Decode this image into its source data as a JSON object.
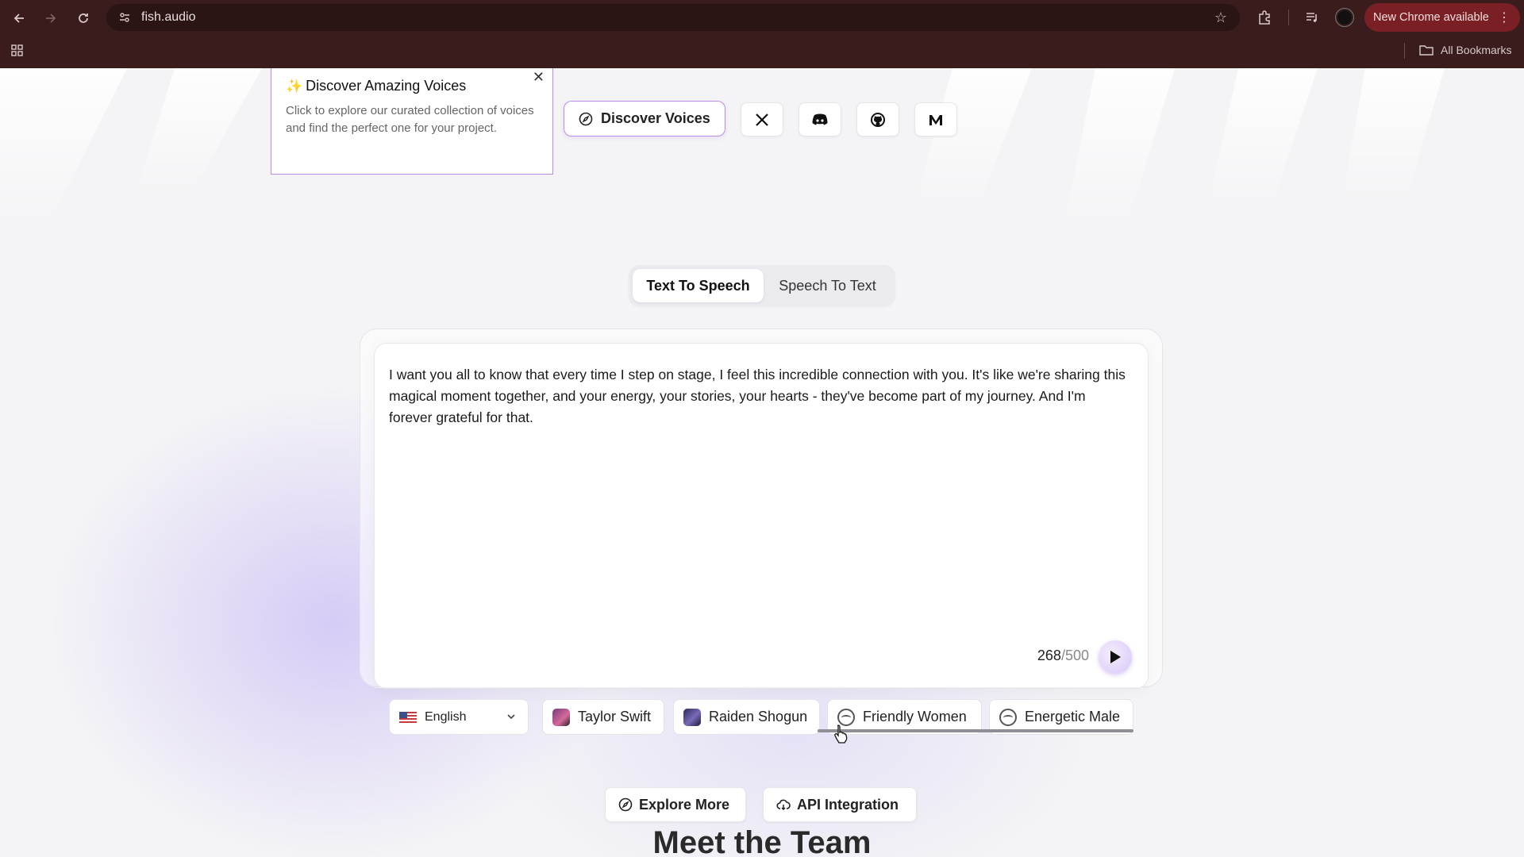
{
  "browser": {
    "url": "fish.audio",
    "update_label": "New Chrome available",
    "bookmarks_label": "All Bookmarks",
    "tab_color": "#3a1c1c"
  },
  "tooltip": {
    "title": "Discover Amazing Voices",
    "body": "Click to explore our curated collection of voices and find the perfect one for your project.",
    "close_glyph": "✕"
  },
  "header": {
    "discover_label": "Discover Voices",
    "socials": [
      "x-icon",
      "discord-icon",
      "github-icon",
      "medium-icon"
    ]
  },
  "tabs": [
    {
      "label": "Text To Speech",
      "active": true
    },
    {
      "label": "Speech To Text",
      "active": false
    }
  ],
  "editor": {
    "text": "I want you all to know that every time I step on stage, I feel this incredible connection with you. It's like we're sharing this magical moment together, and your energy, your stories, your hearts - they've become part of my journey. And I'm forever grateful for that.",
    "char_count": "268",
    "char_max": "/500"
  },
  "language": {
    "selected": "English"
  },
  "voices": [
    {
      "label": "Taylor Swift"
    },
    {
      "label": "Raiden Shogun"
    },
    {
      "label": "Friendly Women"
    },
    {
      "label": "Energetic Male"
    }
  ],
  "actions": {
    "explore": "Explore More",
    "api": "API Integration"
  },
  "section": {
    "heading": "Meet the Team"
  },
  "colors": {
    "accent": "#b98ee6",
    "chrome_bg": "#3a1c1c",
    "update_pill": "#7a2025"
  }
}
